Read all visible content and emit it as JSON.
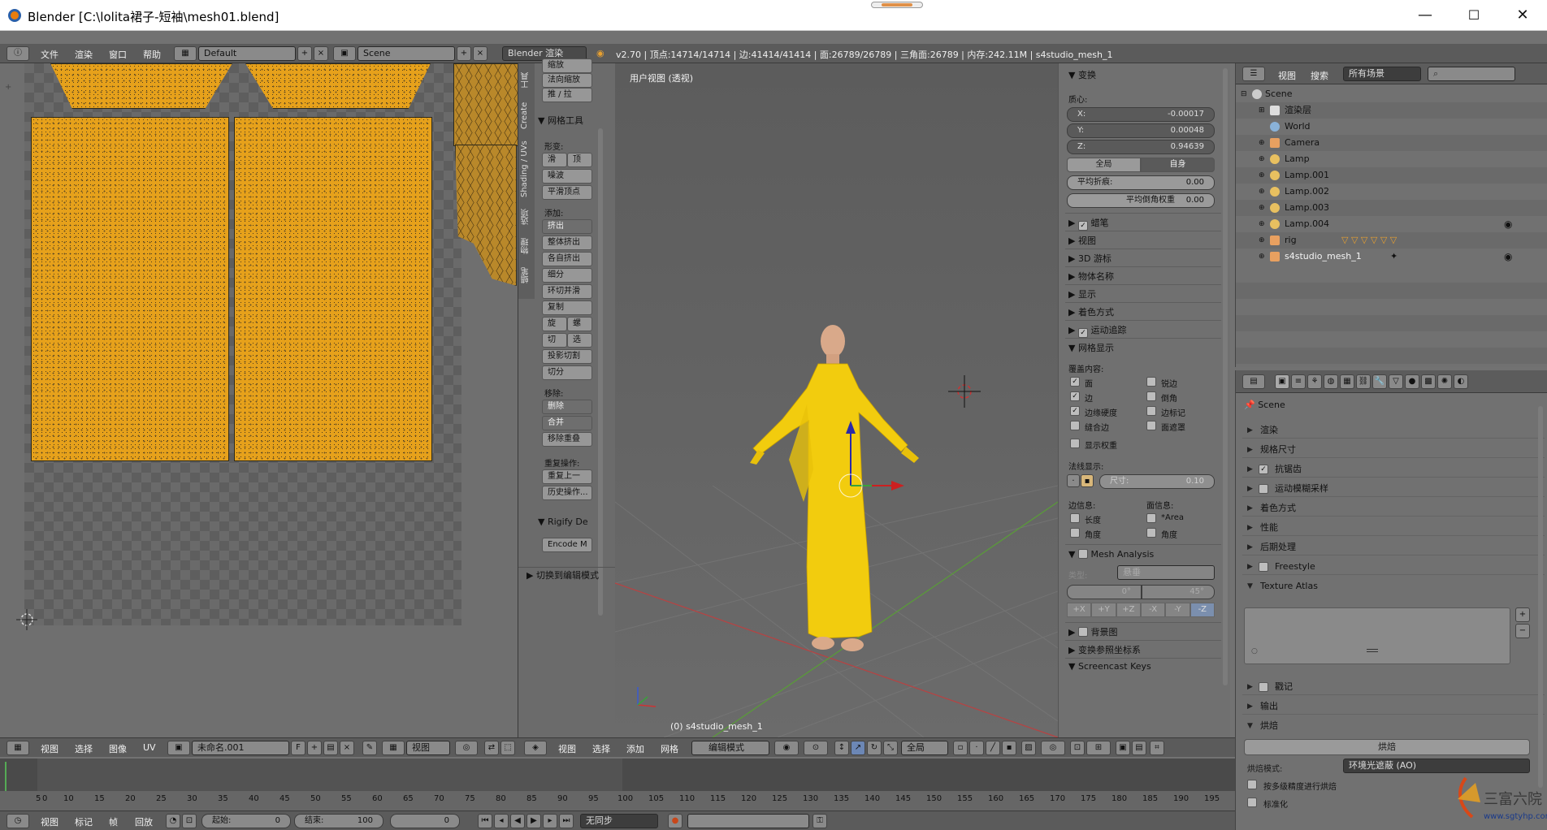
{
  "window": {
    "title": "Blender [C:\\lolita裙子-短袖\\mesh01.blend]",
    "controls": [
      "—",
      "☐",
      "✕"
    ]
  },
  "info_header": {
    "menus": [
      "文件",
      "渲染",
      "窗口",
      "帮助"
    ],
    "layout": "Default",
    "scene": "Scene",
    "engine": "Blender 渲染",
    "stats": "v2.70 | 顶点:14714/14714 | 边:41414/41414 | 面:26789/26789 | 三角面:26789 | 内存:242.11M | s4studio_mesh_1"
  },
  "toolshelf": {
    "tabs": [
      "工具",
      "Create",
      "Shading / UVs",
      "选项",
      "物理",
      "蜡笔"
    ],
    "top_buttons": [
      "缩放",
      "法向缩放",
      "推 / 拉"
    ],
    "mesh_tools_title": "网格工具",
    "deform_label": "形变:",
    "deform_row": [
      "滑",
      "顶"
    ],
    "deform_buttons": [
      "噪波",
      "平滑顶点"
    ],
    "add_label": "添加:",
    "add_buttons": [
      "挤出",
      "整体挤出",
      "各自挤出",
      "细分",
      "环切并滑",
      "复制"
    ],
    "add_pairs": [
      [
        "旋",
        "螺"
      ],
      [
        "切",
        "选"
      ]
    ],
    "add_buttons_2": [
      "投影切割",
      "切分"
    ],
    "remove_label": "移除:",
    "remove_buttons": [
      "删除",
      "合并",
      "移除重叠"
    ],
    "repeat_label": "重复操作:",
    "repeat_buttons": [
      "重复上一",
      "历史操作..."
    ],
    "rigify_title": "Rigify De",
    "encode_button": "Encode M",
    "toggle_edit": "切换到编辑模式"
  },
  "viewport": {
    "label": "用户视图 (透视)",
    "object_label": "(0) s4studio_mesh_1"
  },
  "npanel": {
    "transform_title": "变换",
    "median_label": "质心:",
    "x": {
      "k": "X:",
      "v": "-0.00017"
    },
    "y": {
      "k": "Y:",
      "v": "0.00048"
    },
    "z": {
      "k": "Z:",
      "v": "0.94639"
    },
    "global_btn": "全局",
    "local_btn": "自身",
    "crease": {
      "k": "平均折痕:",
      "v": "0.00"
    },
    "bevel": {
      "k": "平均倒角权重",
      "v": "0.00"
    },
    "sections": [
      "蜡笔",
      "视图",
      "3D 游标",
      "物体名称",
      "显示",
      "着色方式",
      "运动追踪",
      "网格显示"
    ],
    "overlay_label": "覆盖内容:",
    "overlay_left": [
      "面",
      "边",
      "边缘硬度",
      "缝合边",
      "显示权重"
    ],
    "overlay_right": [
      "锐边",
      "倒角",
      "边标记",
      "面遮罩"
    ],
    "normals_label": "法线显示:",
    "normals_size": "尺寸:",
    "normals_value": "0.10",
    "edge_info": "边信息:",
    "face_info": "面信息:",
    "edge_items": [
      "长度",
      "角度"
    ],
    "face_items": [
      "*Area",
      "角度"
    ],
    "mesh_analysis": "Mesh Analysis",
    "type_label": "类型:",
    "type_value": "悬垂",
    "range_a": "0°",
    "range_b": "45°",
    "axes": [
      "+X",
      "+Y",
      "+Z",
      "-X",
      "-Y",
      "-Z"
    ],
    "more_sections": [
      "背景图",
      "变换参照坐标系",
      "Screencast Keys"
    ]
  },
  "outliner": {
    "menus": [
      "视图",
      "搜索"
    ],
    "filter": "所有场景",
    "rows": [
      "Scene",
      "渲染层",
      "World",
      "Camera",
      "Lamp",
      "Lamp.001",
      "Lamp.002",
      "Lamp.003",
      "Lamp.004",
      "rig",
      "s4studio_mesh_1"
    ]
  },
  "properties": {
    "context": "Scene",
    "panels": [
      "渲染",
      "规格尺寸",
      "抗锯齿",
      "运动模糊采样",
      "着色方式",
      "性能",
      "后期处理",
      "Freestyle",
      "Texture Atlas",
      "戳记",
      "输出",
      "烘焙"
    ],
    "bake_button": "烘焙",
    "bake_mode_label": "烘焙模式:",
    "bake_mode_value": "环境光遮蔽 (AO)",
    "bake_opt1": "按多级精度进行烘焙",
    "bake_opt2": "标准化"
  },
  "uv_header": {
    "menus": [
      "视图",
      "选择",
      "图像",
      "UV"
    ],
    "image": "未命名.001",
    "f": "F",
    "view": "视图"
  },
  "view3d_header": {
    "menus": [
      "视图",
      "选择",
      "添加",
      "网格"
    ],
    "mode": "编辑模式",
    "orientation": "全局"
  },
  "timeline": {
    "ticks": [
      "5",
      "0",
      "10",
      "15",
      "20",
      "25",
      "30",
      "35",
      "40",
      "45",
      "50",
      "55",
      "60",
      "65",
      "70",
      "75",
      "80",
      "85",
      "90",
      "95",
      "100",
      "105",
      "110",
      "115",
      "120",
      "125",
      "130",
      "135",
      "140",
      "145",
      "150",
      "155",
      "160",
      "165",
      "170",
      "175",
      "180",
      "185",
      "190",
      "195"
    ]
  },
  "timeline_header": {
    "menus": [
      "视图",
      "标记",
      "帧",
      "回放"
    ],
    "start_label": "起始:",
    "start_value": "0",
    "end_label": "结束:",
    "end_value": "100",
    "current": "0",
    "sync": "无同步"
  },
  "watermark": {
    "site": "www.sgtyhp.com"
  }
}
